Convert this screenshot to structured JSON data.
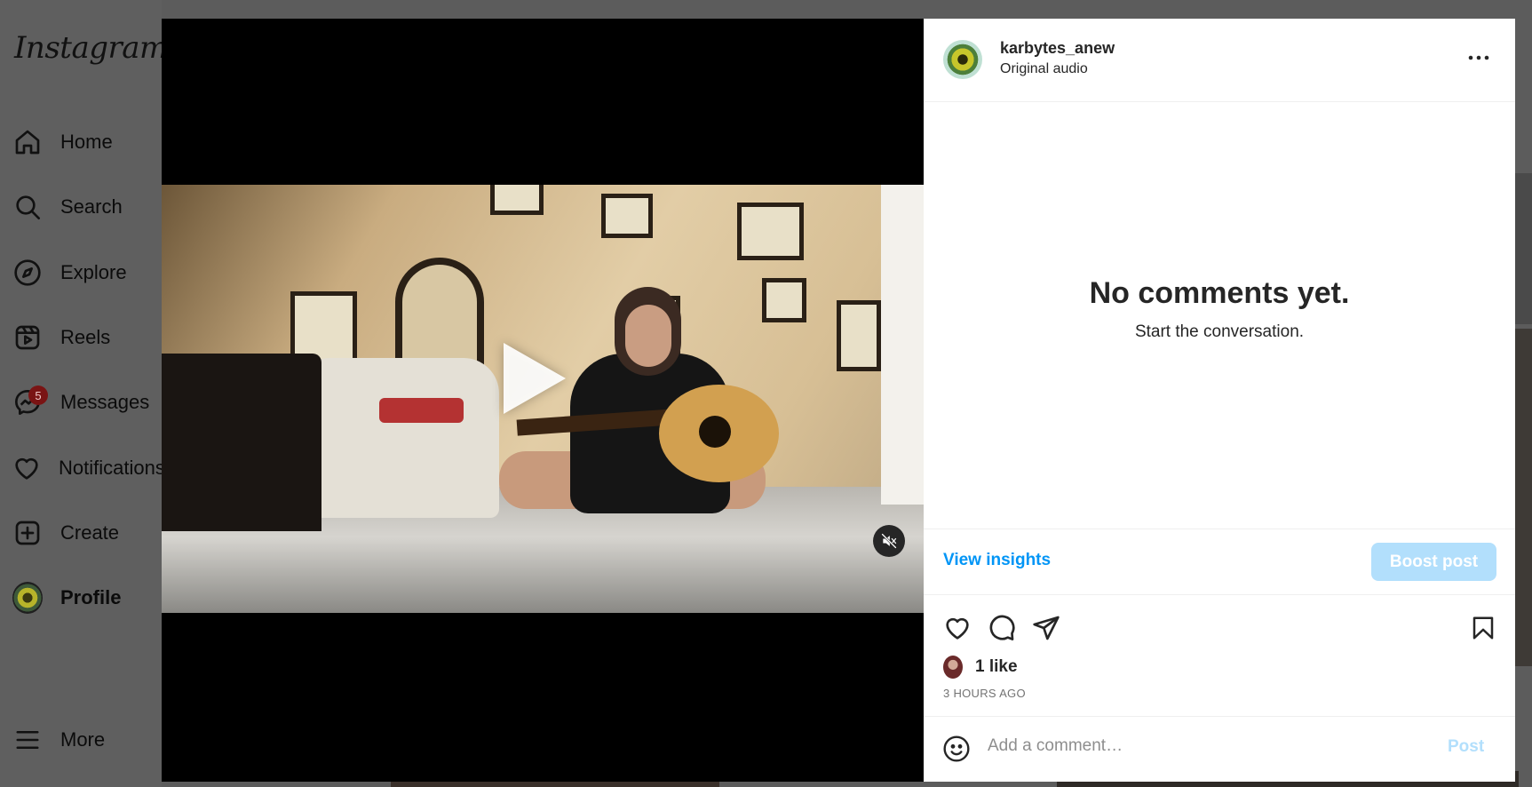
{
  "app": {
    "logo_text": "Instagram"
  },
  "sidebar": {
    "items": [
      {
        "label": "Home",
        "icon": "home-icon"
      },
      {
        "label": "Search",
        "icon": "search-icon"
      },
      {
        "label": "Explore",
        "icon": "compass-icon"
      },
      {
        "label": "Reels",
        "icon": "reels-icon"
      },
      {
        "label": "Messages",
        "icon": "messenger-icon",
        "badge": "5"
      },
      {
        "label": "Notifications",
        "icon": "heart-icon"
      },
      {
        "label": "Create",
        "icon": "plus-square-icon"
      },
      {
        "label": "Profile",
        "icon": "profile-avatar"
      }
    ],
    "more_label": "More"
  },
  "post": {
    "username": "karbytes_anew",
    "audio_label": "Original audio",
    "no_comments_title": "No comments yet.",
    "no_comments_subtitle": "Start the conversation.",
    "view_insights_label": "View insights",
    "boost_label": "Boost post",
    "like_count_text": "1 like",
    "time_ago": "3 HOURS AGO",
    "comment_placeholder": "Add a comment…",
    "post_label": "Post"
  },
  "colors": {
    "accent": "#0095f6",
    "accent_disabled": "#b2dffc",
    "badge": "#7a1414",
    "overlay": "#5f5f5f"
  }
}
